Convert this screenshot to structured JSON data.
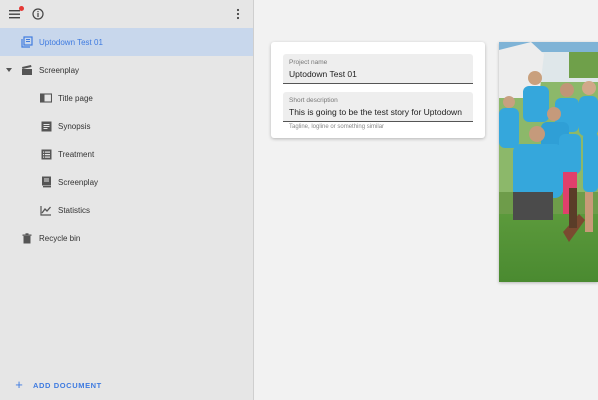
{
  "sidebar": {
    "items": [
      {
        "label": "Uptodown Test 01",
        "icon": "book-stack-icon"
      },
      {
        "label": "Screenplay",
        "icon": "clapperboard-icon"
      },
      {
        "label": "Title page",
        "icon": "open-book-icon"
      },
      {
        "label": "Synopsis",
        "icon": "document-lines-icon"
      },
      {
        "label": "Treatment",
        "icon": "list-document-icon"
      },
      {
        "label": "Screenplay",
        "icon": "script-icon"
      },
      {
        "label": "Statistics",
        "icon": "line-chart-icon"
      },
      {
        "label": "Recycle bin",
        "icon": "trash-icon"
      }
    ],
    "add_document_label": "ADD DOCUMENT"
  },
  "project": {
    "name_label": "Project name",
    "name_value": "Uptodown Test 01",
    "description_label": "Short description",
    "description_value": "This is going to be the test story for Uptodown",
    "description_hint": "Tagline, logline or something similar"
  },
  "colors": {
    "accent": "#3f7be0",
    "active_background": "#c8d7ec",
    "sidebar_background": "#e6e6e6",
    "notification_dot": "#e53935"
  }
}
